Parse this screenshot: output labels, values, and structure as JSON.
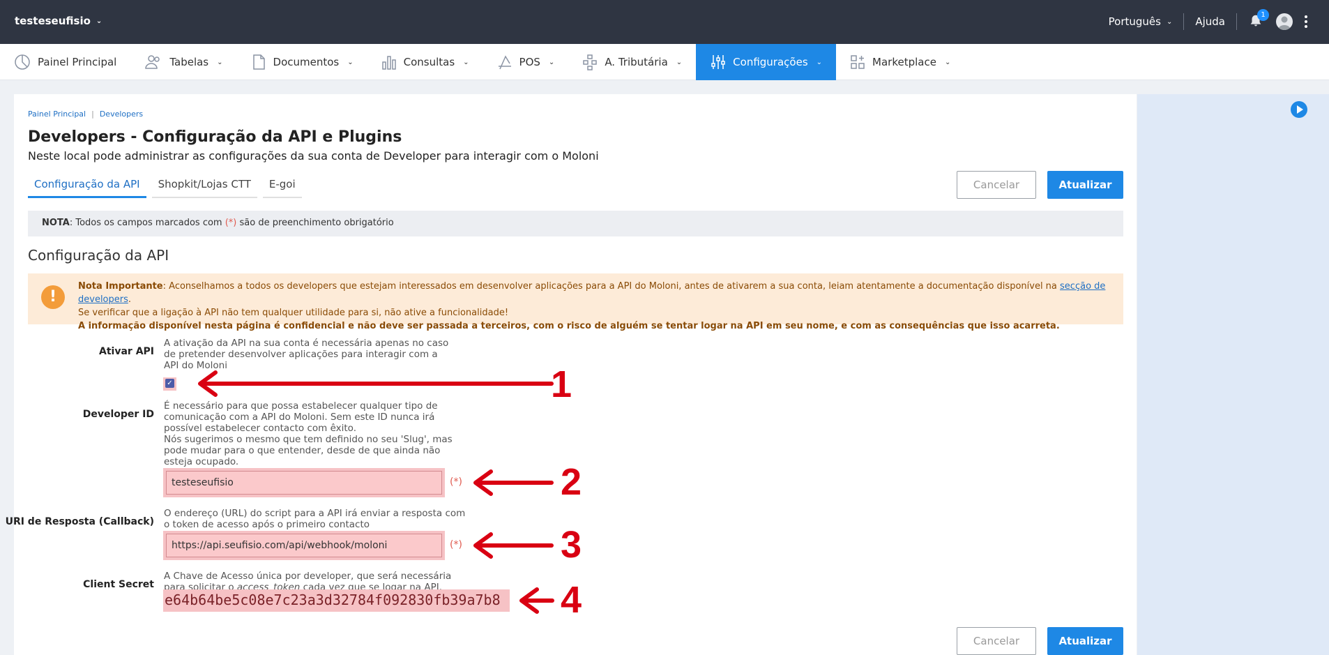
{
  "topbar": {
    "account": "testeseufisio",
    "language": "Português",
    "help": "Ajuda",
    "notif_count": "1"
  },
  "nav": [
    {
      "label": "Painel Principal",
      "icon": "pie-chart-icon"
    },
    {
      "label": "Tabelas",
      "icon": "users-icon"
    },
    {
      "label": "Documentos",
      "icon": "document-icon"
    },
    {
      "label": "Consultas",
      "icon": "bar-chart-icon"
    },
    {
      "label": "POS",
      "icon": "pos-icon"
    },
    {
      "label": "A. Tributária",
      "icon": "network-icon"
    },
    {
      "label": "Configurações",
      "icon": "sliders-icon"
    },
    {
      "label": "Marketplace",
      "icon": "grid-icon"
    }
  ],
  "breadcrumb": [
    "Painel Principal",
    "Developers"
  ],
  "page": {
    "title": "Developers - Configuração da API e Plugins",
    "subtitle": "Neste local pode administrar as configurações da sua conta de Developer para interagir com o Moloni"
  },
  "tabs": [
    "Configuração da API",
    "Shopkit/Lojas CTT",
    "E-goi"
  ],
  "buttons": {
    "cancel": "Cancelar",
    "update": "Atualizar"
  },
  "note": {
    "prefix": "NOTA",
    "text_before": ": Todos os campos marcados com ",
    "mark": "(*)",
    "text_after": " são de preenchimento obrigatório"
  },
  "section_title": "Configuração da API",
  "warning": {
    "label": "Nota Importante",
    "line1": ": Aconselhamos a todos os developers que estejam interessados em desenvolver aplicações para a API do Moloni, antes de ativarem a sua conta, leiam atentamente a documentação disponível na ",
    "link": "secção de developers",
    "line1_end": ".",
    "line2": "Se verificar que a ligação à API não tem qualquer utilidade para si, não ative a funcionalidade!",
    "line3": "A informação disponível nesta página é confidencial e não deve ser passada a terceiros, com o risco de alguém se tentar logar na API em seu nome, e com as consequências que isso acarreta."
  },
  "fields": {
    "ativar": {
      "label": "Ativar API",
      "help": "A ativação da API na sua conta é necessária apenas no caso de pretender desenvolver aplicações para interagir com a API do Moloni",
      "checked": true
    },
    "developer_id": {
      "label": "Developer ID",
      "help1": "É necessário para que possa estabelecer qualquer tipo de comunicação com a API do Moloni. Sem este ID nunca irá possível estabelecer contacto com êxito.",
      "help2": "Nós sugerimos o mesmo que tem definido no seu 'Slug', mas pode mudar para o que entender, desde de que ainda não esteja ocupado.",
      "value": "testeseufisio",
      "required": "(*)"
    },
    "callback": {
      "label": "URI de Resposta (Callback)",
      "help": "O endereço (URL) do script para a API irá enviar a resposta com o token de acesso após o primeiro contacto",
      "value": "https://api.seufisio.com/api/webhook/moloni",
      "required": "(*)"
    },
    "secret": {
      "label": "Client Secret",
      "help_before": "A Chave de Acesso única por developer, que será necessária para solicitar o ",
      "help_em": "access_token",
      "help_after": " cada vez que se logar na API.",
      "value": "e64b64be5c08e7c23a3d32784f092830fb39a7b8"
    }
  },
  "annotations": [
    "1",
    "2",
    "3",
    "4"
  ],
  "colors": {
    "accent": "#1e88e5",
    "annotation": "#d90012",
    "highlight": "#f6c2c5"
  }
}
